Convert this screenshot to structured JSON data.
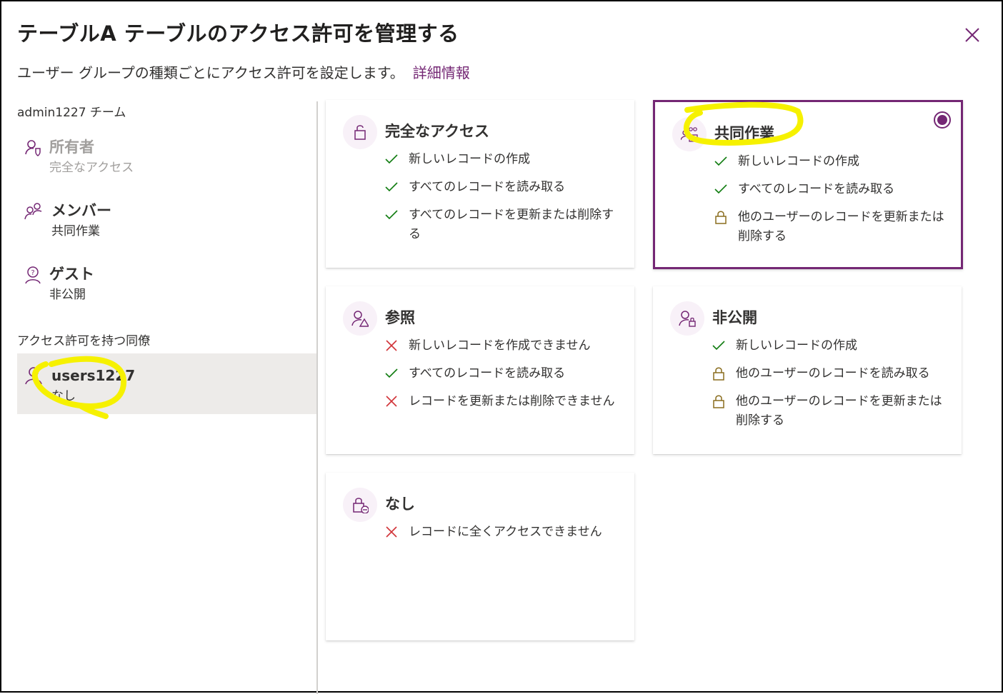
{
  "dialog": {
    "title": "テーブルA テーブルのアクセス許可を管理する",
    "subtitle": "ユーザー グループの種類ごとにアクセス許可を設定します。",
    "learn_more": "詳細情報"
  },
  "sidebar": {
    "team_label": "admin1227 チーム",
    "roles": [
      {
        "name": "所有者",
        "access": "完全なアクセス",
        "icon": "owner-icon",
        "disabled": true
      },
      {
        "name": "メンバー",
        "access": "共同作業",
        "icon": "members-icon"
      },
      {
        "name": "ゲスト",
        "access": "非公開",
        "icon": "guest-icon"
      }
    ],
    "peers_label": "アクセス許可を持つ同僚",
    "peers": [
      {
        "name": "users1227",
        "access": "なし",
        "icon": "user-icon",
        "selected": true
      }
    ]
  },
  "cards": [
    {
      "title": "完全なアクセス",
      "icon": "unlock-icon",
      "selected": false,
      "items": [
        {
          "mark": "check",
          "text": "新しいレコードの作成"
        },
        {
          "mark": "check",
          "text": "すべてのレコードを読み取る"
        },
        {
          "mark": "check",
          "text": "すべてのレコードを更新または削除する"
        }
      ]
    },
    {
      "title": "共同作業",
      "icon": "collaborate-icon",
      "selected": true,
      "items": [
        {
          "mark": "check",
          "text": "新しいレコードの作成"
        },
        {
          "mark": "check",
          "text": "すべてのレコードを読み取る"
        },
        {
          "mark": "lock",
          "text": "他のユーザーのレコードを更新または削除する"
        }
      ]
    },
    {
      "title": "参照",
      "icon": "reference-icon",
      "selected": false,
      "items": [
        {
          "mark": "cross",
          "text": "新しいレコードを作成できません"
        },
        {
          "mark": "check",
          "text": "すべてのレコードを読み取る"
        },
        {
          "mark": "cross",
          "text": "レコードを更新または削除できません"
        }
      ]
    },
    {
      "title": "非公開",
      "icon": "private-icon",
      "selected": false,
      "items": [
        {
          "mark": "check",
          "text": "新しいレコードの作成"
        },
        {
          "mark": "lock",
          "text": "他のユーザーのレコードを読み取る"
        },
        {
          "mark": "lock",
          "text": "他のユーザーのレコードを更新または削除する"
        }
      ]
    },
    {
      "title": "なし",
      "icon": "no-access-icon",
      "selected": false,
      "items": [
        {
          "mark": "cross",
          "text": "レコードに全くアクセスできません"
        }
      ]
    }
  ],
  "colors": {
    "accent": "#742774",
    "check": "#107c10",
    "cross": "#d13438",
    "lock": "#8a6d1e",
    "highlight": "#f6f100"
  }
}
